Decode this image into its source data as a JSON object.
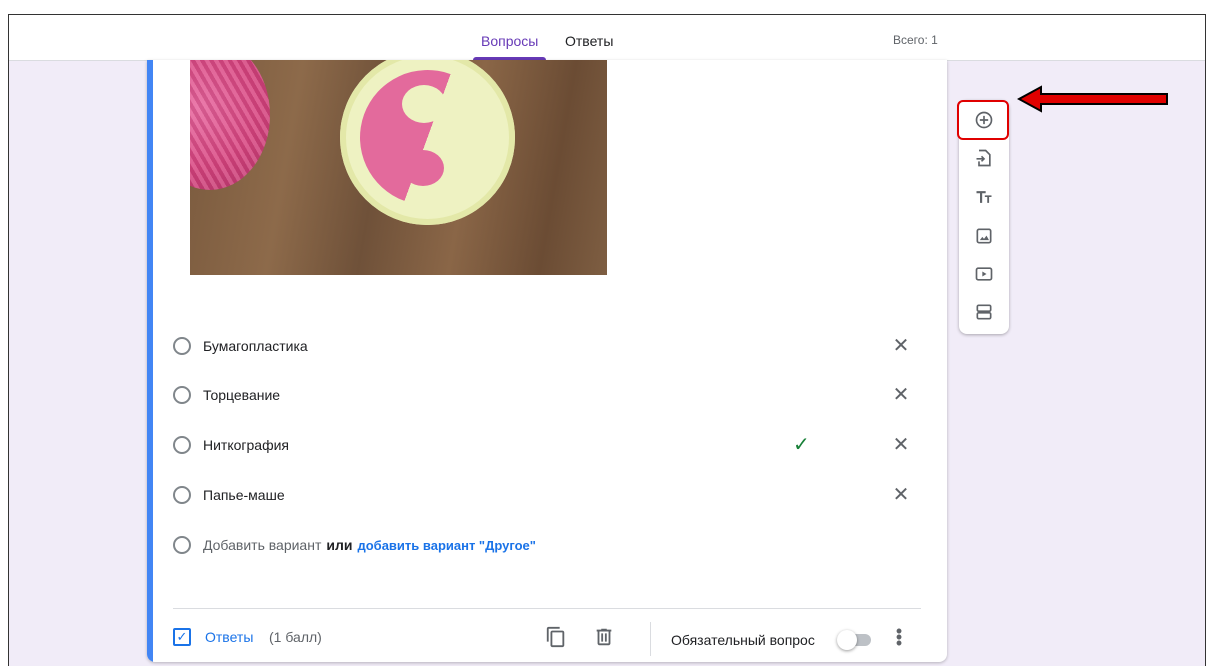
{
  "header": {
    "tabs": [
      {
        "label": "Вопросы",
        "active": true
      },
      {
        "label": "Ответы",
        "active": false
      }
    ],
    "total": "Всего: 1"
  },
  "question": {
    "options": [
      {
        "label": "Бумагопластика",
        "correct": false
      },
      {
        "label": "Торцевание",
        "correct": false
      },
      {
        "label": "Ниткография",
        "correct": true
      },
      {
        "label": "Папье-маше",
        "correct": false
      }
    ],
    "add_option": "Добавить вариант",
    "or": "или",
    "add_other": "добавить вариант \"Другое\""
  },
  "footer": {
    "answers_label": "Ответы",
    "points": "(1 балл)",
    "required_label": "Обязательный вопрос",
    "required_on": false
  },
  "toolbar": {
    "items": [
      "add-question-icon",
      "import-questions-icon",
      "add-title-icon",
      "add-image-icon",
      "add-video-icon",
      "add-section-icon"
    ]
  },
  "colors": {
    "accent": "#673ab7",
    "card_stripe": "#4285f4",
    "link": "#1a73e8",
    "correct": "#188038",
    "highlight": "#e00000"
  }
}
